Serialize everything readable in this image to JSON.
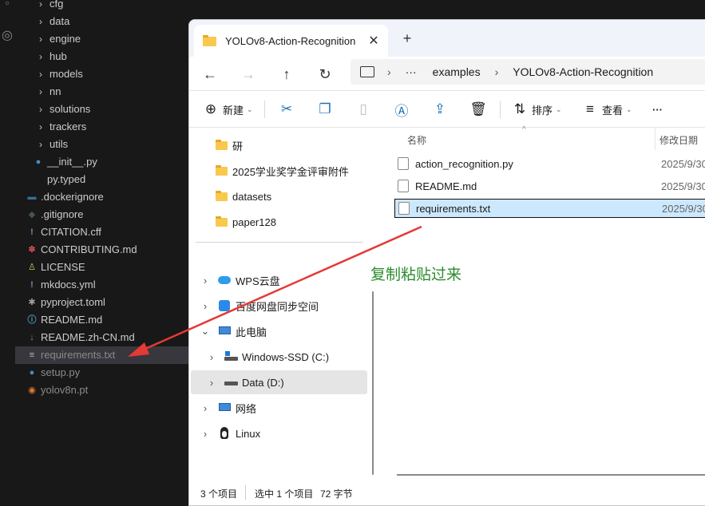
{
  "vscode": {
    "tree": [
      {
        "label": "cfg",
        "kind": "folder"
      },
      {
        "label": "data",
        "kind": "folder"
      },
      {
        "label": "engine",
        "kind": "folder"
      },
      {
        "label": "hub",
        "kind": "folder"
      },
      {
        "label": "models",
        "kind": "folder"
      },
      {
        "label": "nn",
        "kind": "folder"
      },
      {
        "label": "solutions",
        "kind": "folder"
      },
      {
        "label": "trackers",
        "kind": "folder"
      },
      {
        "label": "utils",
        "kind": "folder"
      },
      {
        "label": "__init__.py",
        "kind": "python"
      },
      {
        "label": "py.typed",
        "kind": "text"
      },
      {
        "label": ".dockerignore",
        "kind": "docker"
      },
      {
        "label": ".gitignore",
        "kind": "git"
      },
      {
        "label": "CITATION.cff",
        "kind": "exclaim"
      },
      {
        "label": "CONTRIBUTING.md",
        "kind": "ribbon"
      },
      {
        "label": "LICENSE",
        "kind": "license"
      },
      {
        "label": "mkdocs.yml",
        "kind": "exclaim"
      },
      {
        "label": "pyproject.toml",
        "kind": "gear"
      },
      {
        "label": "README.md",
        "kind": "info"
      },
      {
        "label": "README.zh-CN.md",
        "kind": "markdown"
      },
      {
        "label": "requirements.txt",
        "kind": "lines"
      },
      {
        "label": "setup.py",
        "kind": "python"
      },
      {
        "label": "yolov8n.pt",
        "kind": "rss"
      }
    ]
  },
  "explorer": {
    "tab_title": "YOLOv8-Action-Recognition",
    "tab_close": "✕",
    "new_tab": "+",
    "address": {
      "ellipsis": "···",
      "crumbs": [
        "examples",
        "YOLOv8-Action-Recognition"
      ]
    },
    "toolbar": {
      "new_label": "新建",
      "sort_label": "排序",
      "view_label": "查看",
      "more": "···"
    },
    "nav": {
      "quick": [
        "研",
        "2025学业奖学金评审附件",
        "datasets",
        "paper128"
      ],
      "tree": [
        {
          "label": "WPS云盘",
          "icon": "cloud"
        },
        {
          "label": "百度网盘同步空间",
          "icon": "baidu"
        },
        {
          "label": "此电脑",
          "icon": "pc"
        },
        {
          "label": "Windows-SSD (C:)",
          "icon": "drive-c"
        },
        {
          "label": "Data (D:)",
          "icon": "drive-d"
        },
        {
          "label": "网络",
          "icon": "network"
        },
        {
          "label": "Linux",
          "icon": "linux"
        }
      ]
    },
    "columns": {
      "name": "名称",
      "modified": "修改日期"
    },
    "files": [
      {
        "name": "action_recognition.py",
        "modified": "2025/9/30"
      },
      {
        "name": "README.md",
        "modified": "2025/9/30"
      },
      {
        "name": "requirements.txt",
        "modified": "2025/9/30"
      }
    ],
    "status": {
      "count": "3 个项目",
      "selected": "选中 1 个项目",
      "size": "72 字节"
    }
  },
  "annotation": {
    "text": "复制粘贴过来",
    "color": "#e53935"
  }
}
